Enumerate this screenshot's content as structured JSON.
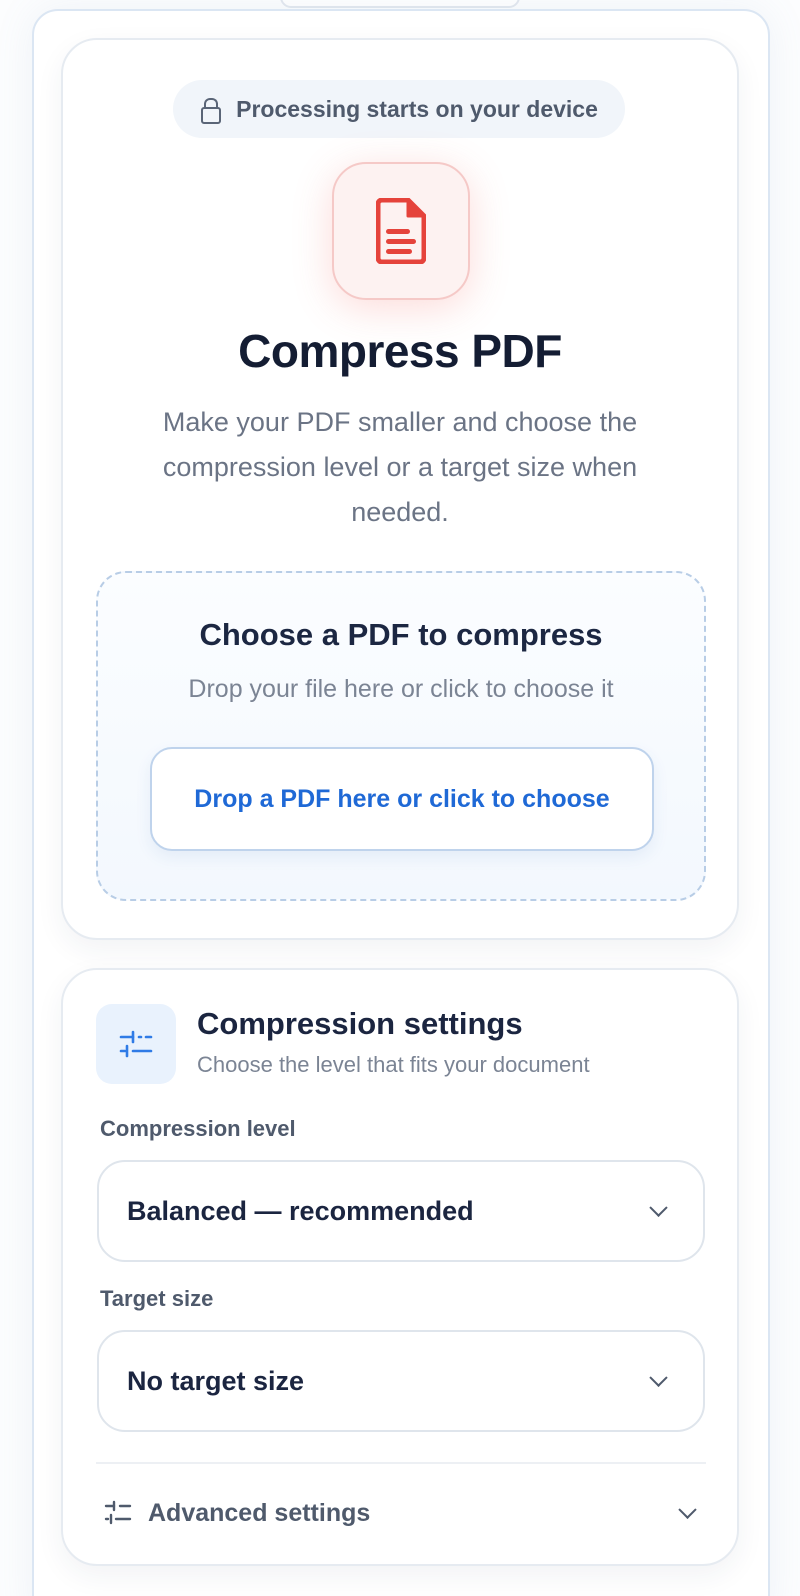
{
  "badge": {
    "icon": "lock-icon",
    "text": "Processing starts on your device"
  },
  "hero": {
    "icon": "pdf-file-icon",
    "title": "Compress PDF",
    "description": "Make your PDF smaller and choose the compression level or a target size when needed."
  },
  "dropzone": {
    "title": "Choose a PDF to compress",
    "subtitle": "Drop your file here or click to choose it",
    "button_label": "Drop a PDF here or click to choose"
  },
  "settings": {
    "icon": "sliders-icon",
    "title": "Compression settings",
    "subtitle": "Choose the level that fits your document",
    "compression_level": {
      "label": "Compression level",
      "value": "Balanced — recommended"
    },
    "target_size": {
      "label": "Target size",
      "value": "No target size"
    },
    "advanced": {
      "icon": "sliders-icon",
      "label": "Advanced settings"
    }
  },
  "colors": {
    "accent_blue": "#1f69d6",
    "pdf_red": "#e5433b",
    "heading": "#141d33",
    "muted_text": "#6b7485"
  }
}
